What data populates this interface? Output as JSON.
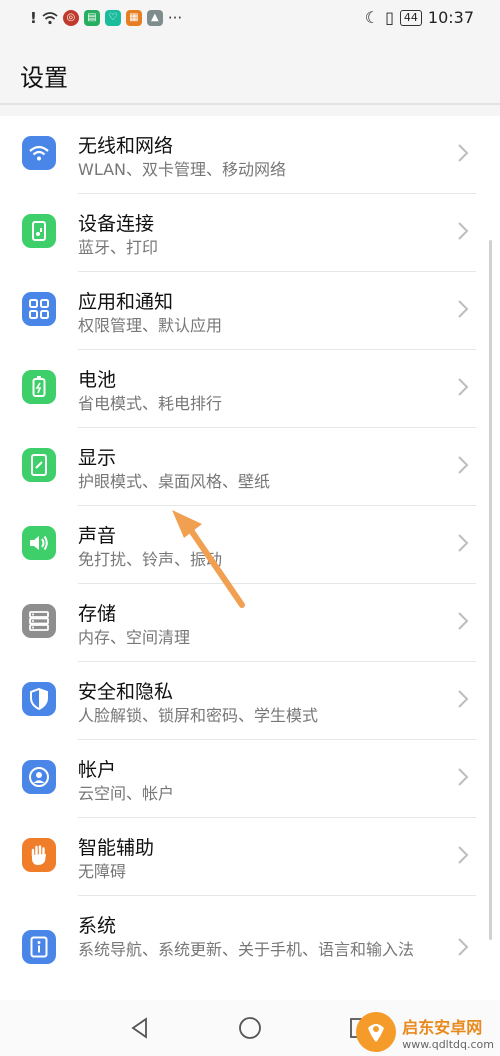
{
  "status_bar": {
    "time": "10:37",
    "battery": "44",
    "left_icons": [
      "alert-icon",
      "wifi-icon",
      "app-badge-red",
      "app-badge-green",
      "app-badge-teal",
      "app-badge-orange",
      "app-badge-gray"
    ],
    "more": "···"
  },
  "header": {
    "title": "设置"
  },
  "items": [
    {
      "label": "无线和网络",
      "sub": "WLAN、双卡管理、移动网络",
      "icon": "wifi-icon",
      "color": "#4a86e8"
    },
    {
      "label": "设备连接",
      "sub": "蓝牙、打印",
      "icon": "device-connect-icon",
      "color": "#3ecf6b"
    },
    {
      "label": "应用和通知",
      "sub": "权限管理、默认应用",
      "icon": "apps-grid-icon",
      "color": "#4a86e8"
    },
    {
      "label": "电池",
      "sub": "省电模式、耗电排行",
      "icon": "battery-icon",
      "color": "#3ecf6b"
    },
    {
      "label": "显示",
      "sub": "护眼模式、桌面风格、壁纸",
      "icon": "display-icon",
      "color": "#3ecf6b"
    },
    {
      "label": "声音",
      "sub": "免打扰、铃声、振动",
      "icon": "speaker-icon",
      "color": "#3ecf6b"
    },
    {
      "label": "存储",
      "sub": "内存、空间清理",
      "icon": "storage-icon",
      "color": "#8e8e8e"
    },
    {
      "label": "安全和隐私",
      "sub": "人脸解锁、锁屏和密码、学生模式",
      "icon": "shield-icon",
      "color": "#4a86e8"
    },
    {
      "label": "帐户",
      "sub": "云空间、帐户",
      "icon": "account-icon",
      "color": "#4a86e8"
    },
    {
      "label": "智能辅助",
      "sub": "无障碍",
      "icon": "hand-icon",
      "color": "#f07d2a"
    },
    {
      "label": "系统",
      "sub": "系统导航、系统更新、关于手机、语言和输入法",
      "icon": "system-info-icon",
      "color": "#4a86e8"
    }
  ],
  "watermark": {
    "main": "启东安卓网",
    "url": "www.qdltdq.com"
  },
  "accent": {
    "arrow": "#f0a050"
  }
}
